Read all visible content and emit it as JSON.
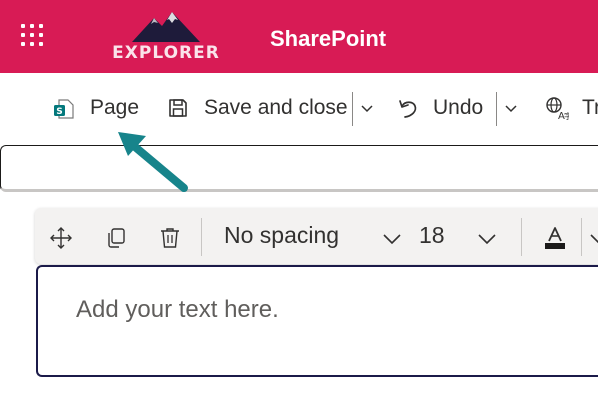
{
  "suite_bar": {
    "app_name": "SharePoint",
    "logo_text": "EXPLORER",
    "color": "#d81b55"
  },
  "command_bar": {
    "page_label": "Page",
    "save_label": "Save and close",
    "undo_label": "Undo",
    "translate_label": "Tr"
  },
  "text_toolbar": {
    "paragraph_style": "No spacing",
    "font_size": "18"
  },
  "editor": {
    "placeholder": "Add your text here."
  },
  "icons": {
    "waffle": "app-launcher-icon",
    "page": "page-icon",
    "save": "save-icon",
    "undo": "undo-icon",
    "translate": "translate-icon",
    "move": "move-icon",
    "duplicate": "duplicate-icon",
    "delete": "trash-icon",
    "font_color": "font-color-icon"
  },
  "accent": "#17848b"
}
